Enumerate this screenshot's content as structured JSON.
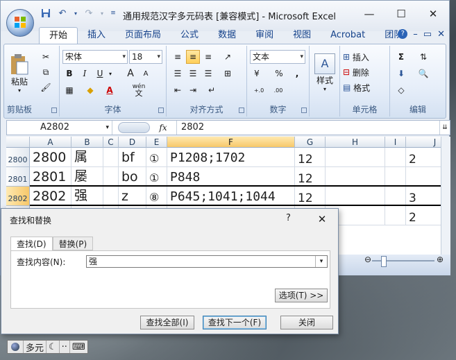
{
  "window": {
    "title": "通用规范汉字多元码表  [兼容模式] - Microsoft Excel",
    "controls": {
      "minimize": "—",
      "maximize": "☐",
      "close": "✕"
    }
  },
  "ribbon_tabs": [
    "开始",
    "插入",
    "页面布局",
    "公式",
    "数据",
    "审阅",
    "视图",
    "Acrobat",
    "团队"
  ],
  "ribbon": {
    "clipboard": {
      "label": "剪贴板",
      "paste": "粘贴"
    },
    "font": {
      "label": "字体",
      "font_name": "宋体",
      "font_size": "18",
      "bold": "B",
      "italic": "I",
      "underline": "U",
      "grow": "A",
      "shrink": "A",
      "color_letter": "A",
      "wen": "wén",
      "wen_char": "文"
    },
    "alignment": {
      "label": "对齐方式"
    },
    "number": {
      "label": "数字",
      "format": "文本",
      "percent": "%",
      "comma": ","
    },
    "styles": {
      "label": "样式"
    },
    "cells": {
      "label": "单元格",
      "insert": "插入",
      "delete": "删除",
      "format": "格式"
    },
    "editing": {
      "label": "编辑"
    }
  },
  "formula_bar": {
    "name_box": "A2802",
    "fx": "fx",
    "value": "2802"
  },
  "sheet": {
    "columns": [
      "A",
      "B",
      "C",
      "D",
      "E",
      "F",
      "G",
      "H",
      "I",
      "J"
    ],
    "selected_column": "F",
    "rows": [
      {
        "num": "2800",
        "cells": [
          "2800",
          "属",
          "",
          "bf",
          "①",
          "P1208;1702",
          "12",
          "",
          "",
          "2"
        ]
      },
      {
        "num": "2801",
        "cells": [
          "2801",
          "屡",
          "",
          "bo",
          "①",
          "P848",
          "12",
          "",
          "",
          ""
        ]
      },
      {
        "num": "2802",
        "cells": [
          "2802",
          "强",
          "",
          "z",
          "⑧",
          "P645;1041;1044",
          "12",
          "",
          "",
          "3"
        ]
      },
      {
        "num": "",
        "cells": [
          "",
          "",
          "",
          "",
          "",
          "",
          "",
          "",
          "",
          "2"
        ]
      }
    ]
  },
  "dialog": {
    "title": "查找和替换",
    "help": "?",
    "close": "✕",
    "tabs": [
      "查找(D)",
      "替换(P)"
    ],
    "find_label": "查找内容(N):",
    "find_value": "强",
    "options_button": "选项(T) >>",
    "find_all": "查找全部(I)",
    "find_next": "查找下一个(F)",
    "close_button": "关闭"
  },
  "ime_bar": {
    "mode": "多元",
    "moon": "☾",
    "dots": "··",
    "keyboard": "⌨"
  }
}
